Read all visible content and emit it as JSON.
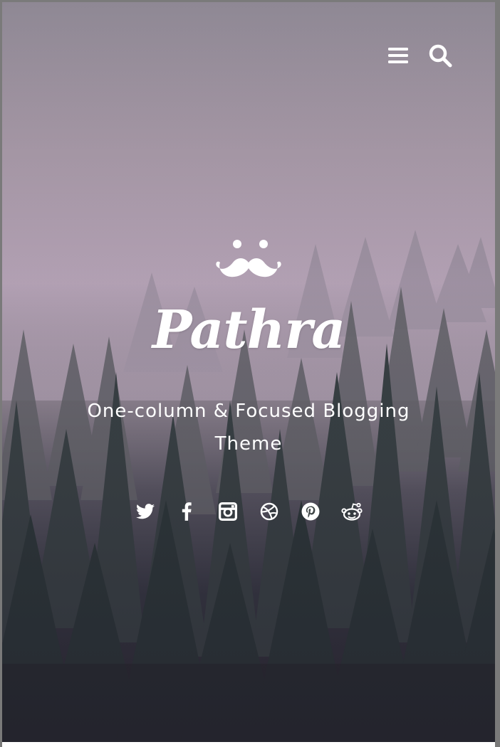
{
  "site": {
    "title": "Pathra",
    "tagline": "One-column & Focused Blogging Theme"
  },
  "header": {
    "icons": [
      "menu-icon",
      "search-icon"
    ]
  },
  "social_links": [
    {
      "name": "twitter",
      "icon": "twitter-icon"
    },
    {
      "name": "facebook",
      "icon": "facebook-icon"
    },
    {
      "name": "instagram",
      "icon": "instagram-icon"
    },
    {
      "name": "dribbble",
      "icon": "dribbble-icon"
    },
    {
      "name": "pinterest",
      "icon": "pinterest-icon"
    },
    {
      "name": "reddit",
      "icon": "reddit-icon"
    }
  ],
  "colors": {
    "text": "#ffffff",
    "hero_top": "#8f8a94",
    "hero_bottom": "#222428"
  }
}
